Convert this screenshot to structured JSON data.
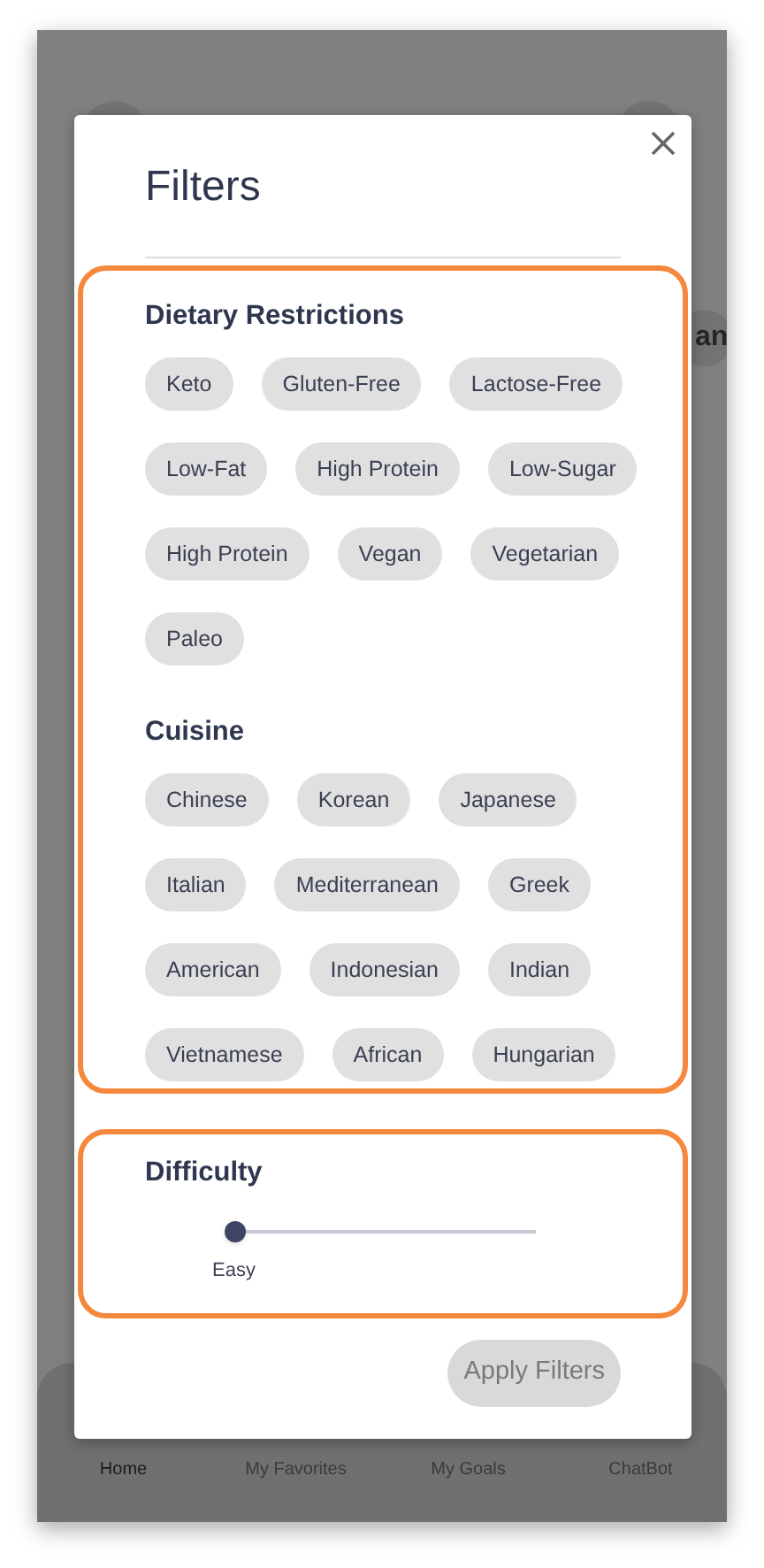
{
  "background": {
    "peek_text": "an",
    "nav": [
      {
        "label": "Home",
        "selected": true
      },
      {
        "label": "My Favorites",
        "selected": false
      },
      {
        "label": "My Goals",
        "selected": false
      },
      {
        "label": "ChatBot",
        "selected": false
      }
    ]
  },
  "modal": {
    "title": "Filters",
    "sections": [
      {
        "title": "Dietary Restrictions",
        "options": [
          {
            "label": "Keto",
            "selected": false
          },
          {
            "label": "Gluten-Free",
            "selected": false
          },
          {
            "label": "Lactose-Free",
            "selected": false
          },
          {
            "label": "Low-Fat",
            "selected": false
          },
          {
            "label": "High Protein",
            "selected": false
          },
          {
            "label": "Low-Sugar",
            "selected": false
          },
          {
            "label": "High Protein",
            "selected": false
          },
          {
            "label": "Vegan",
            "selected": false
          },
          {
            "label": "Vegetarian",
            "selected": false
          },
          {
            "label": "Paleo",
            "selected": false
          }
        ]
      },
      {
        "title": "Cuisine",
        "options": [
          {
            "label": "Chinese",
            "selected": false
          },
          {
            "label": "Korean",
            "selected": false
          },
          {
            "label": "Japanese",
            "selected": false
          },
          {
            "label": "Italian",
            "selected": false
          },
          {
            "label": "Mediterranean",
            "selected": false
          },
          {
            "label": "Greek",
            "selected": false
          },
          {
            "label": "American",
            "selected": false
          },
          {
            "label": "Indonesian",
            "selected": false
          },
          {
            "label": "Indian",
            "selected": false
          },
          {
            "label": "Vietnamese",
            "selected": false
          },
          {
            "label": "African",
            "selected": false
          },
          {
            "label": "Hungarian",
            "selected": false
          }
        ]
      }
    ],
    "difficulty": {
      "title": "Difficulty",
      "level": 0,
      "reading": "Easy"
    },
    "apply_button": {
      "label": "Apply Filters",
      "disabled": true
    }
  }
}
